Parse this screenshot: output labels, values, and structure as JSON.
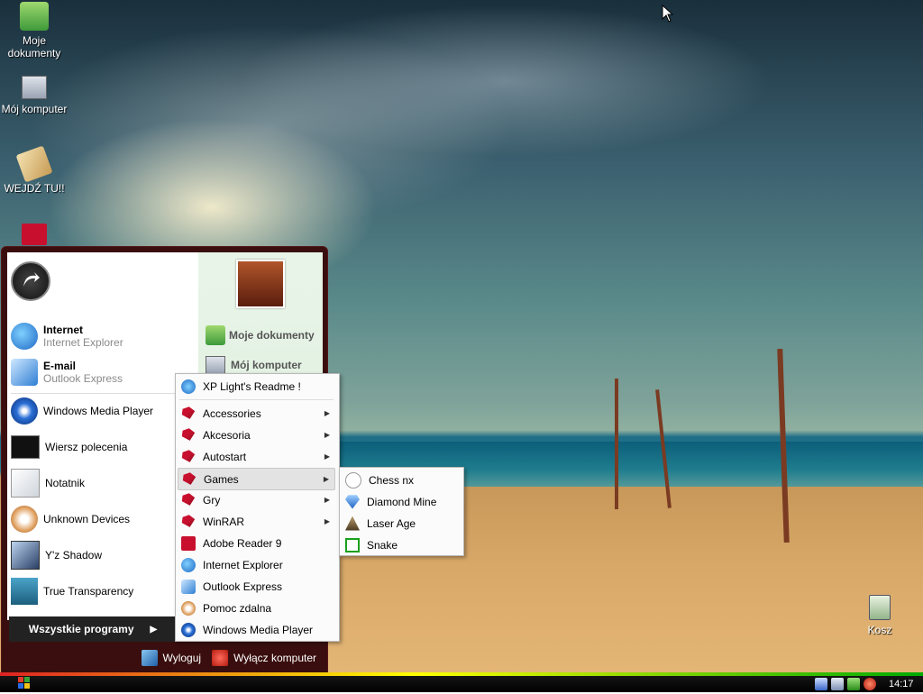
{
  "desktop": {
    "icons": [
      {
        "label": "Moje dokumenty",
        "icon": "my-documents-icon"
      },
      {
        "label": "Mój komputer",
        "icon": "my-computer-icon"
      },
      {
        "label": "WEJDŹ TU!!",
        "icon": "note-icon"
      },
      {
        "label": "Kosz",
        "icon": "recycle-bin-icon"
      }
    ]
  },
  "start_menu": {
    "user_avatar": "chess-pieces-avatar",
    "pinned": [
      {
        "title": "Internet",
        "subtitle": "Internet Explorer",
        "icon": "internet-explorer-icon"
      },
      {
        "title": "E-mail",
        "subtitle": "Outlook Express",
        "icon": "outlook-express-icon"
      }
    ],
    "recent": [
      {
        "label": "Windows Media Player",
        "icon": "media-player-icon"
      },
      {
        "label": "Wiersz polecenia",
        "icon": "command-prompt-icon"
      },
      {
        "label": "Notatnik",
        "icon": "notepad-icon"
      },
      {
        "label": "Unknown Devices",
        "icon": "devices-icon"
      },
      {
        "label": "Y'z Shadow",
        "icon": "shadow-icon"
      },
      {
        "label": "True Transparency",
        "icon": "transparency-icon"
      }
    ],
    "all_programs_label": "Wszystkie programy",
    "right_items": [
      {
        "label": "Moje dokumenty",
        "icon": "my-documents-icon"
      },
      {
        "label": "Mój komputer",
        "icon": "my-computer-icon"
      }
    ],
    "logoff_label": "Wyloguj",
    "shutdown_label": "Wyłącz komputer"
  },
  "programs_menu": {
    "items": [
      {
        "label": "XP Light's Readme !",
        "icon": "readme-icon",
        "submenu": false
      },
      {
        "label": "Accessories",
        "icon": "folder-icon",
        "submenu": true
      },
      {
        "label": "Akcesoria",
        "icon": "folder-icon",
        "submenu": true
      },
      {
        "label": "Autostart",
        "icon": "folder-icon",
        "submenu": true
      },
      {
        "label": "Games",
        "icon": "folder-icon",
        "submenu": true,
        "selected": true
      },
      {
        "label": "Gry",
        "icon": "folder-icon",
        "submenu": true
      },
      {
        "label": "WinRAR",
        "icon": "folder-icon",
        "submenu": true
      },
      {
        "label": "Adobe Reader 9",
        "icon": "adobe-reader-icon",
        "submenu": false
      },
      {
        "label": "Internet Explorer",
        "icon": "internet-explorer-icon",
        "submenu": false
      },
      {
        "label": "Outlook Express",
        "icon": "outlook-express-icon",
        "submenu": false
      },
      {
        "label": "Pomoc zdalna",
        "icon": "remote-help-icon",
        "submenu": false
      },
      {
        "label": "Windows Media Player",
        "icon": "media-player-icon",
        "submenu": false
      }
    ]
  },
  "games_menu": {
    "items": [
      {
        "label": "Chess nx",
        "icon": "chess-icon"
      },
      {
        "label": "Diamond Mine",
        "icon": "diamond-icon"
      },
      {
        "label": "Laser Age",
        "icon": "laser-icon"
      },
      {
        "label": "Snake",
        "icon": "snake-icon"
      }
    ]
  },
  "taskbar": {
    "clock": "14:17",
    "tray_icons": [
      "network-icon",
      "display-icon",
      "update-icon",
      "security-icon"
    ]
  }
}
